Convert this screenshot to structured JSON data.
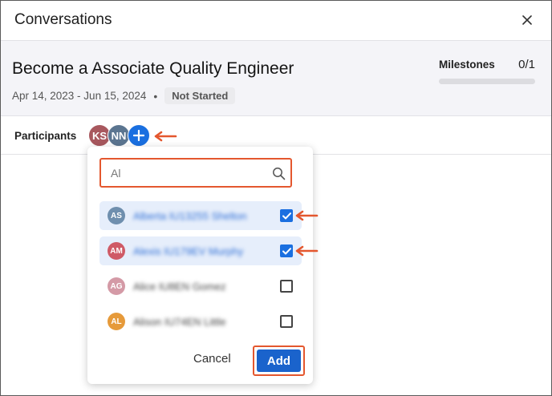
{
  "header": {
    "title": "Conversations"
  },
  "goal": {
    "title": "Become a Associate Quality Engineer",
    "dates": "Apr 14, 2023 - Jun 15, 2024",
    "separator": "•",
    "status": "Not Started",
    "milestones_label": "Milestones",
    "milestones_count": "0/1",
    "milestones_progress": 0
  },
  "participants": {
    "label": "Participants",
    "avatars": [
      {
        "initials": "KS",
        "color": "#a8585e"
      },
      {
        "initials": "NN",
        "color": "#5b7590"
      }
    ]
  },
  "dropdown": {
    "search_value": "Al",
    "users": [
      {
        "initials": "AS",
        "name": "Alberta IU13255 Shelton",
        "color": "#6f8fae",
        "checked": true
      },
      {
        "initials": "AM",
        "name": "Alexis IU179EV Murphy",
        "color": "#cf5a66",
        "checked": true
      },
      {
        "initials": "AG",
        "name": "Alice IU8EN Gomez",
        "color": "#d49aa6",
        "checked": false
      },
      {
        "initials": "AL",
        "name": "Alison IU74EN Little",
        "color": "#e69a3a",
        "checked": false
      }
    ],
    "cancel_label": "Cancel",
    "add_label": "Add"
  },
  "colors": {
    "accent": "#1a6fe0",
    "highlight": "#e4572e"
  }
}
